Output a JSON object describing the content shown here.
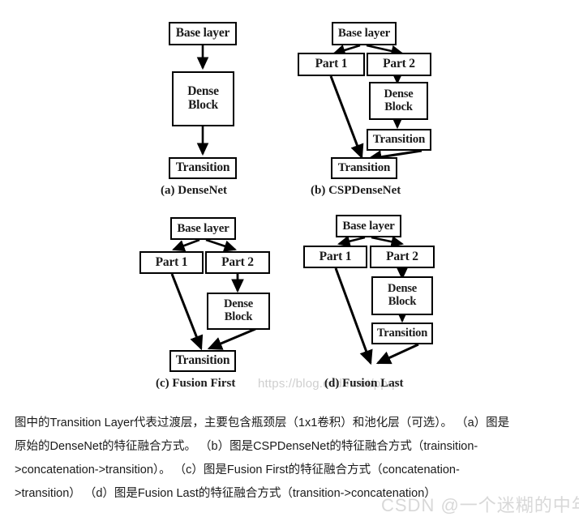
{
  "figure": {
    "panels": [
      {
        "id": "a",
        "caption": "(a) DenseNet",
        "nodes": [
          {
            "name": "base-layer",
            "lines": [
              "Base layer"
            ]
          },
          {
            "name": "dense-block",
            "lines": [
              "Dense",
              "Block"
            ]
          },
          {
            "name": "transition",
            "lines": [
              "Transition"
            ]
          }
        ]
      },
      {
        "id": "b",
        "caption": "(b) CSPDenseNet",
        "nodes": [
          {
            "name": "base-layer",
            "lines": [
              "Base layer"
            ]
          },
          {
            "name": "part-1",
            "lines": [
              "Part 1"
            ]
          },
          {
            "name": "part-2",
            "lines": [
              "Part 2"
            ]
          },
          {
            "name": "dense-block",
            "lines": [
              "Dense",
              "Block"
            ]
          },
          {
            "name": "transition-upper",
            "lines": [
              "Transition"
            ]
          },
          {
            "name": "transition-lower",
            "lines": [
              "Transition"
            ]
          }
        ]
      },
      {
        "id": "c",
        "caption": "(c) Fusion First",
        "nodes": [
          {
            "name": "base-layer",
            "lines": [
              "Base layer"
            ]
          },
          {
            "name": "part-1",
            "lines": [
              "Part 1"
            ]
          },
          {
            "name": "part-2",
            "lines": [
              "Part 2"
            ]
          },
          {
            "name": "dense-block",
            "lines": [
              "Dense",
              "Block"
            ]
          },
          {
            "name": "transition",
            "lines": [
              "Transition"
            ]
          }
        ]
      },
      {
        "id": "d",
        "caption": "(d) Fusion Last",
        "nodes": [
          {
            "name": "base-layer",
            "lines": [
              "Base layer"
            ]
          },
          {
            "name": "part-1",
            "lines": [
              "Part 1"
            ]
          },
          {
            "name": "part-2",
            "lines": [
              "Part 2"
            ]
          },
          {
            "name": "dense-block",
            "lines": [
              "Dense",
              "Block"
            ]
          },
          {
            "name": "transition",
            "lines": [
              "Transition"
            ]
          }
        ]
      }
    ],
    "watermark": "https://blog.csdn.net/pprp"
  },
  "caption": {
    "line1": "图中的Transition Layer代表过渡层，主要包含瓶颈层（1x1卷积）和池化层（可选）。 （a）图是",
    "line2": "原始的DenseNet的特征融合方式。 （b）图是CSPDenseNet的特征融合方式（trainsition-",
    "line3": ">concatenation->transition）。 （c）图是Fusion First的特征融合方式（concatenation-",
    "line4": ">transition） （d）图是Fusion Last的特征融合方式（transition->concatenation）"
  },
  "footer": {
    "watermark": "CSDN @一个迷糊的中年男大"
  },
  "colors": {
    "stroke": "#000000",
    "box_fill": "#ffffff",
    "text": "#1b1b1b",
    "watermark": "#cfcfcf",
    "background": "#ffffff"
  }
}
